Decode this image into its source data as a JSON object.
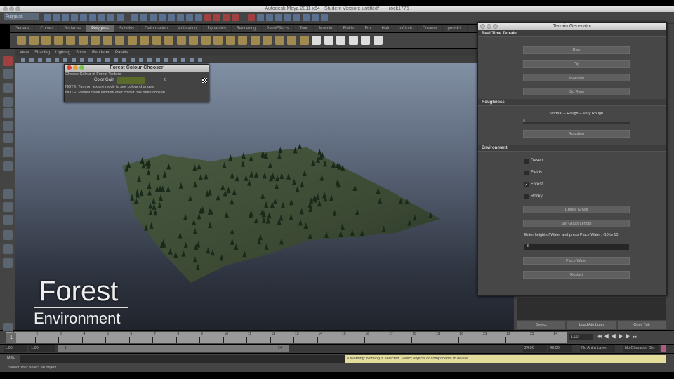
{
  "window": {
    "title": "Autodesk Maya 2011 x64 - Student Version: untitled*   ----   rock1776"
  },
  "toolbar": {
    "mode": "Polygons"
  },
  "shelf_tabs": [
    "General",
    "Curves",
    "Surfaces",
    "Polygons",
    "Subdivs",
    "Deformation",
    "Animation",
    "Dynamics",
    "Rendering",
    "PaintEffects",
    "Toon",
    "Muscle",
    "Fluids",
    "Fur",
    "Hair",
    "nCloth",
    "Custom",
    "pushKit"
  ],
  "active_shelf": "Polygons",
  "viewport_menu": [
    "View",
    "Shading",
    "Lighting",
    "Show",
    "Renderer",
    "Panels"
  ],
  "colour_chooser": {
    "title": "Forest Colour Chooser",
    "subtitle": "Choose Colour of Forest Texture",
    "label": "Color Gain",
    "value": "0",
    "swatch": "#5a6a2a",
    "notes": [
      "NOTE: Turn on texture mode to see colour changes",
      "NOTE: Please close window after colour has been chosen"
    ]
  },
  "terrain_generator": {
    "title": "Terrain Generator",
    "sections": {
      "real_time": "Real Time Terrain",
      "roughness": "Roughness",
      "environment": "Environment"
    },
    "buttons": {
      "rise": "Rise",
      "dig": "Dig",
      "mountain": "Mountain",
      "dig_river": "Dig River",
      "roughen": "Roughen",
      "create_grass": "Create Grass",
      "set_grass_length": "Set Grass Length",
      "place_water": "Place Water",
      "restart": "Restart"
    },
    "roughness_label": "Normal --   Rough   -- Very Rough",
    "roughness_value": "0",
    "environments": [
      {
        "label": "Desert",
        "checked": false
      },
      {
        "label": "Fields",
        "checked": false
      },
      {
        "label": "Forest",
        "checked": true
      },
      {
        "label": "Rocky",
        "checked": false
      }
    ],
    "water_label": "Enter height of Water and press Place Water: -10 to 10",
    "water_value": "-3"
  },
  "overlay": {
    "line1": "Forest",
    "line2": "Environment"
  },
  "panel_buttons": [
    "Select",
    "Load Attributes",
    "Copy Tab"
  ],
  "timeline": {
    "ticks": [
      "1",
      "2",
      "3",
      "4",
      "5",
      "6",
      "7",
      "8",
      "9",
      "10",
      "11",
      "12",
      "13",
      "14",
      "15",
      "16",
      "17",
      "18",
      "19",
      "20",
      "21",
      "22",
      "23",
      "24"
    ],
    "current": "1.00",
    "current_frame": "1"
  },
  "range": {
    "start": "1.00",
    "inner_start": "1.00",
    "slider_start": "1",
    "slider_end": "24",
    "end": "24.00",
    "outer_end": "48.00",
    "anim_layer": "No Anim Layer",
    "char_set": "No Character Set"
  },
  "mel": {
    "label": "MEL",
    "warning": "// Warning: Nothing is selected. Select objects or components to delete."
  },
  "status": "Select Tool: select an object"
}
